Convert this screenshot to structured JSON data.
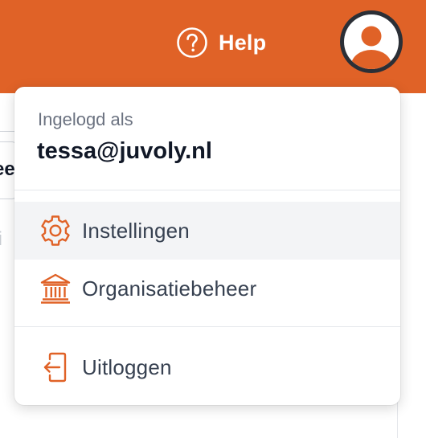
{
  "header": {
    "help_label": "Help",
    "brand_color": "#e06227"
  },
  "background": {
    "fragment_1": "ee",
    "fragment_2": "ti"
  },
  "account_menu": {
    "caption": "Ingelogd als",
    "email": "tessa@juvoly.nl",
    "items": [
      {
        "label": "Instellingen",
        "icon": "gear-icon"
      },
      {
        "label": "Organisatiebeheer",
        "icon": "building-columns-icon"
      },
      {
        "label": "Uitloggen",
        "icon": "logout-icon"
      }
    ]
  }
}
